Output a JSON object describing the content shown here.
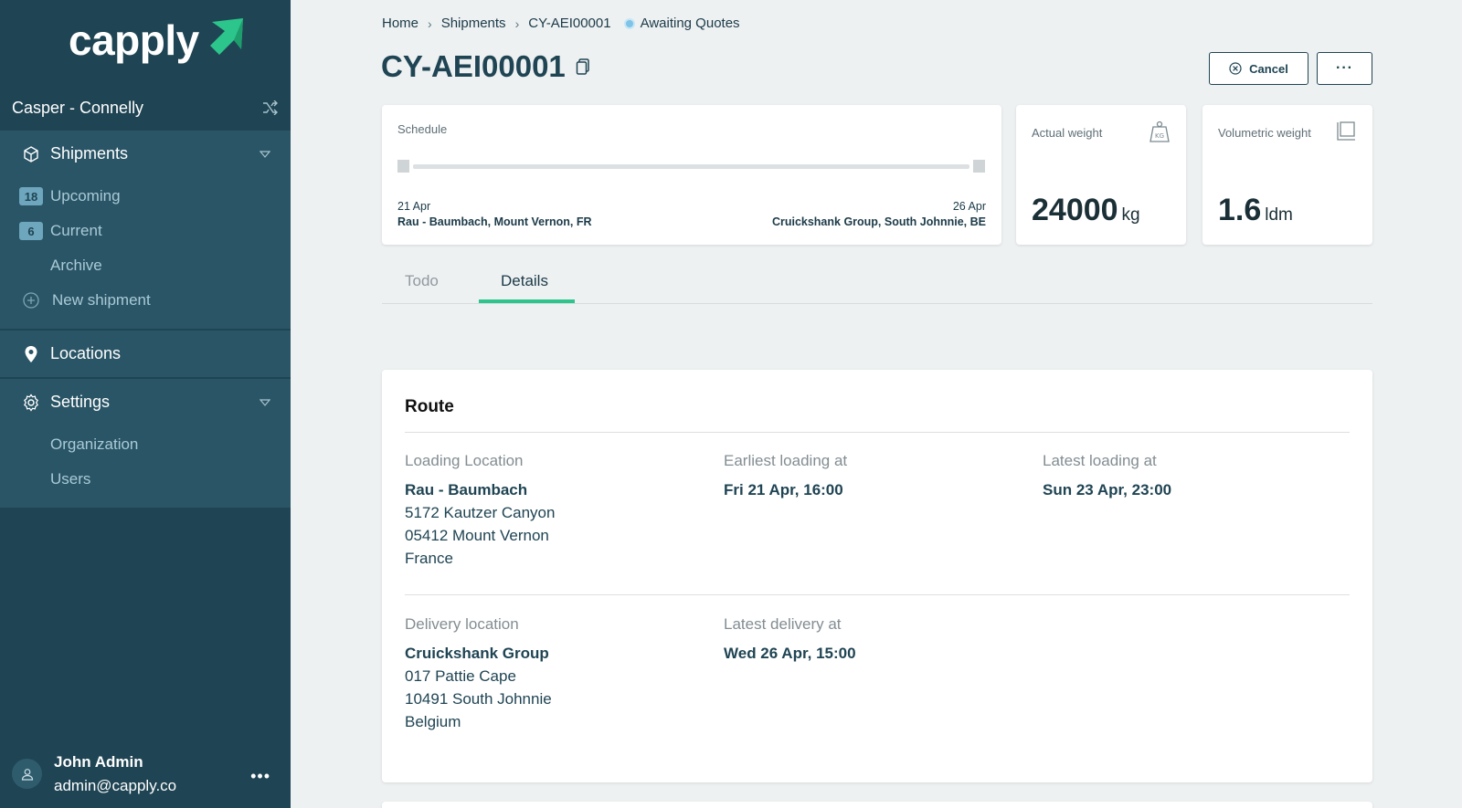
{
  "brand": {
    "name": "capply",
    "accent": "#2cc58b"
  },
  "sidebar": {
    "organization": "Casper - Connelly",
    "shipments": {
      "label": "Shipments",
      "items": [
        {
          "badge": "18",
          "label": "Upcoming"
        },
        {
          "badge": "6",
          "label": "Current"
        },
        {
          "badge": "",
          "label": "Archive"
        },
        {
          "badge": "",
          "label": "New shipment"
        }
      ]
    },
    "locations": {
      "label": "Locations"
    },
    "settings": {
      "label": "Settings",
      "items": [
        {
          "label": "Organization"
        },
        {
          "label": "Users"
        }
      ]
    },
    "user": {
      "name": "John Admin",
      "email": "admin@capply.co"
    }
  },
  "breadcrumb": {
    "home": "Home",
    "shipments": "Shipments",
    "current": "CY-AEI00001",
    "status": "Awaiting Quotes"
  },
  "header": {
    "title": "CY-AEI00001",
    "cancel_label": "Cancel",
    "more_label": "···"
  },
  "schedule": {
    "label": "Schedule",
    "start_date": "21 Apr",
    "start_place": "Rau - Baumbach, Mount Vernon, FR",
    "end_date": "26 Apr",
    "end_place": "Cruickshank Group, South Johnnie, BE"
  },
  "actual_weight": {
    "label": "Actual weight",
    "value": "24000",
    "unit": "kg",
    "icon": "kg-weight-icon"
  },
  "volumetric_weight": {
    "label": "Volumetric weight",
    "value": "1.6",
    "unit": "ldm",
    "icon": "volume-icon"
  },
  "tabs": [
    {
      "label": "Todo",
      "active": false
    },
    {
      "label": "Details",
      "active": true
    }
  ],
  "route": {
    "title": "Route",
    "loading": {
      "label": "Loading Location",
      "name": "Rau - Baumbach",
      "street": "5172 Kautzer Canyon",
      "city": "05412 Mount Vernon",
      "country": "France"
    },
    "earliest_loading": {
      "label": "Earliest loading at",
      "value": "Fri 21 Apr, 16:00"
    },
    "latest_loading": {
      "label": "Latest loading at",
      "value": "Sun 23 Apr, 23:00"
    },
    "delivery": {
      "label": "Delivery location",
      "name": "Cruickshank Group",
      "street": "017 Pattie Cape",
      "city": "10491 South Johnnie",
      "country": "Belgium"
    },
    "latest_delivery": {
      "label": "Latest delivery at",
      "value": "Wed 26 Apr, 15:00"
    }
  }
}
